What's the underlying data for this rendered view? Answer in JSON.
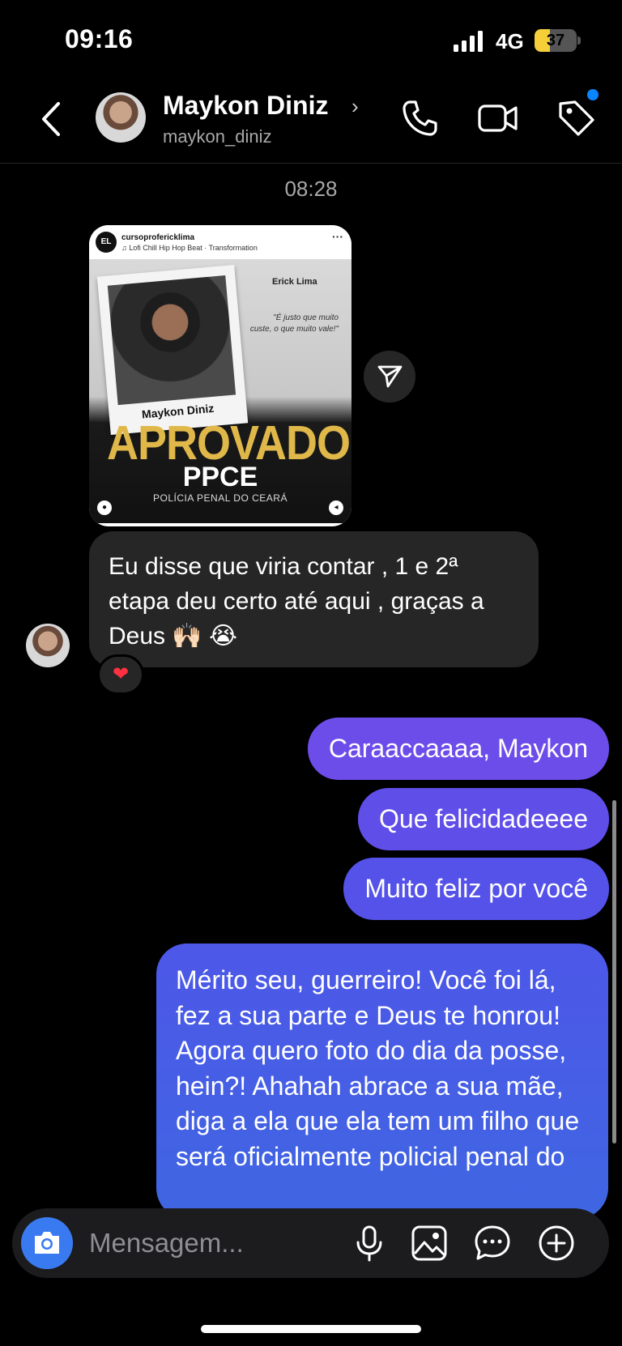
{
  "status_bar": {
    "time": "09:16",
    "network": "4G",
    "battery": "37",
    "battery_fraction": 0.37
  },
  "header": {
    "name": "Maykon Diniz",
    "username": "maykon_diniz"
  },
  "timestamp": "08:28",
  "post": {
    "account": "cursoproferickl​ima",
    "song": "♫ Lofi Chill Hip Hop Beat · Transformation",
    "logo": "EL",
    "brand": "Erick Lima",
    "quote": "\"É justo que muito custe, o que muito vale!\"",
    "photo_caption": "Maykon Diniz",
    "headline": "APROVADO",
    "exam": "PPCE",
    "exam_sub": "POLÍCIA PENAL DO CEARÁ"
  },
  "messages": {
    "incoming": "Eu disse que viria contar , 1 e 2ª etapa deu certo até aqui , graças a Deus 🙌🏻 😭",
    "reaction": "❤",
    "outgoing": [
      "Caraaccaaaa, Maykon",
      "Que felicidadeeee",
      "Muito feliz por você",
      "Mérito seu, guerreiro! Você foi lá, fez a sua parte e Deus te honrou! Agora quero foto do dia da posse, hein?! Ahahah abrace a sua mãe, diga a ela que ela tem um filho que será oficialmente policial penal do"
    ]
  },
  "composer": {
    "placeholder": "Mensagem..."
  },
  "colors": {
    "accent_blue": "#3a7af0",
    "bubble_purple": "#6d4dea",
    "bubble_blue": "#3f66e2",
    "incoming_bubble": "#262626",
    "notification_dot": "#0a84ff"
  }
}
